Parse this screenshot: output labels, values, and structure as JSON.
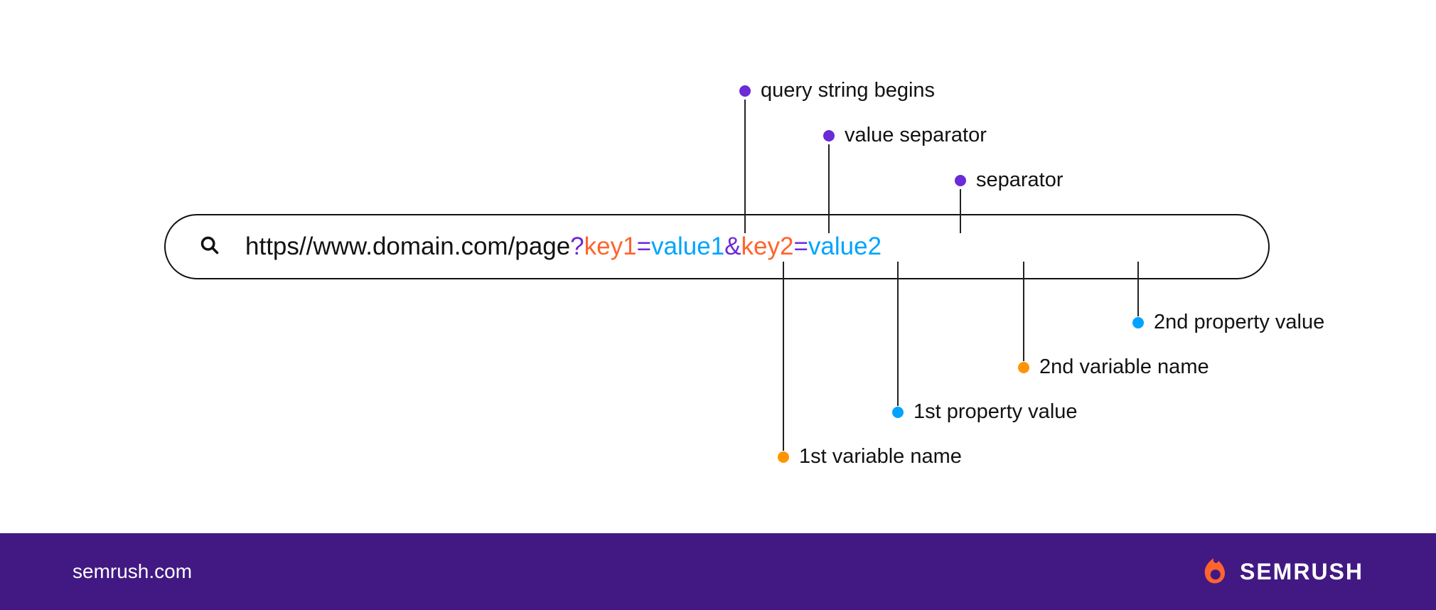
{
  "url": {
    "base": "https//www.domain.com/page",
    "qmark": "?",
    "key1": "key1",
    "eq1": "=",
    "val1": "value1",
    "amp": "&",
    "key2": "key2",
    "eq2": "=",
    "val2": "value2"
  },
  "callouts": {
    "top": {
      "query_begins": "query string begins",
      "value_sep": "value separator",
      "separator": "separator"
    },
    "bottom": {
      "second_val": "2nd property value",
      "second_var": "2nd variable name",
      "first_val": "1st property value",
      "first_var": "1st variable name"
    }
  },
  "footer": {
    "site": "semrush.com",
    "brand": "SEMRUSH"
  },
  "colors": {
    "purple": "#6B2BD6",
    "orange": "#FF642D",
    "blue": "#00A3FF",
    "footer_purple": "#421983",
    "dot_purple": "#6B2BD6",
    "dot_orange": "#FF9500",
    "dot_blue": "#00A3FF"
  }
}
